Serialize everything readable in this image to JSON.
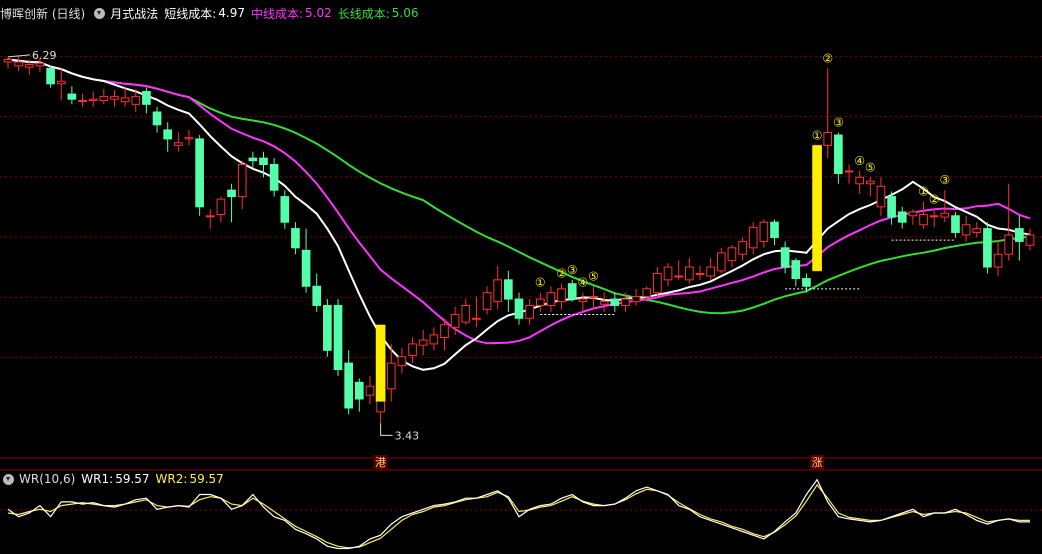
{
  "header": {
    "stock_name": "博晖创新 (日线)",
    "indicator_name": "月式战法",
    "short_label": "短线成本:",
    "short_value": "4.97",
    "mid_label": "中线成本:",
    "mid_value": "5.02",
    "long_label": "长线成本:",
    "long_value": "5.06"
  },
  "sub_header": {
    "indicator": "WR(10,6)",
    "wr1_label": "WR1:",
    "wr1_value": "59.57",
    "wr2_label": "WR2:",
    "wr2_value": "59.57"
  },
  "colors": {
    "up": "#ff3030",
    "down": "#54ffaa",
    "short_line": "#ffffff",
    "mid_line": "#ff33ff",
    "long_line": "#33dd33",
    "signal_bar": "#ffee00",
    "grid": "#8b0000",
    "circle_marker": "#ffee00",
    "wr1": "#ffffff",
    "wr2": "#ffee55"
  },
  "chart_data": {
    "type": "candlestick",
    "price_high_label": "6.29",
    "price_low_label": "3.43",
    "ylim": [
      3.3,
      6.5
    ],
    "candles": [
      [
        6.25,
        6.27,
        6.2,
        6.29
      ],
      [
        6.22,
        6.25,
        6.18,
        6.3
      ],
      [
        6.21,
        6.23,
        6.15,
        6.27
      ],
      [
        6.22,
        6.24,
        6.17,
        6.28
      ],
      [
        6.2,
        6.08,
        6.05,
        6.22
      ],
      [
        6.08,
        6.1,
        5.95,
        6.2
      ],
      [
        6.0,
        5.96,
        5.92,
        6.06
      ],
      [
        5.95,
        5.95,
        5.9,
        6.0
      ],
      [
        5.95,
        5.96,
        5.9,
        6.02
      ],
      [
        5.95,
        5.98,
        5.92,
        6.04
      ],
      [
        5.96,
        5.98,
        5.9,
        6.03
      ],
      [
        5.94,
        5.97,
        5.9,
        6.05
      ],
      [
        5.92,
        5.98,
        5.86,
        6.04
      ],
      [
        6.02,
        5.92,
        5.85,
        6.05
      ],
      [
        5.86,
        5.76,
        5.7,
        5.9
      ],
      [
        5.72,
        5.65,
        5.55,
        5.78
      ],
      [
        5.6,
        5.62,
        5.55,
        5.7
      ],
      [
        5.65,
        5.66,
        5.6,
        5.72
      ],
      [
        5.65,
        5.12,
        5.05,
        5.68
      ],
      [
        5.05,
        5.05,
        4.95,
        5.1
      ],
      [
        5.06,
        5.18,
        5.0,
        5.2
      ],
      [
        5.25,
        5.2,
        5.0,
        5.3
      ],
      [
        5.2,
        5.45,
        5.1,
        5.48
      ],
      [
        5.5,
        5.48,
        5.42,
        5.55
      ],
      [
        5.5,
        5.45,
        5.35,
        5.55
      ],
      [
        5.45,
        5.25,
        5.2,
        5.5
      ],
      [
        5.2,
        5.0,
        4.95,
        5.25
      ],
      [
        4.95,
        4.8,
        4.75,
        5.0
      ],
      [
        4.78,
        4.5,
        4.45,
        4.95
      ],
      [
        4.5,
        4.35,
        4.3,
        4.6
      ],
      [
        4.35,
        4.0,
        3.95,
        4.4
      ],
      [
        4.35,
        3.85,
        3.8,
        4.4
      ],
      [
        3.9,
        3.55,
        3.5,
        4.0
      ],
      [
        3.75,
        3.62,
        3.52,
        3.78
      ],
      [
        3.65,
        3.72,
        3.58,
        3.8
      ],
      [
        3.52,
        3.76,
        3.43,
        3.82
      ],
      [
        3.7,
        3.9,
        3.6,
        4.05
      ],
      [
        3.88,
        3.95,
        3.82,
        4.02
      ],
      [
        3.96,
        4.05,
        3.9,
        4.1
      ],
      [
        4.04,
        4.08,
        3.96,
        4.16
      ],
      [
        4.05,
        4.12,
        4.0,
        4.18
      ],
      [
        4.1,
        4.2,
        4.0,
        4.25
      ],
      [
        4.18,
        4.28,
        4.12,
        4.34
      ],
      [
        4.22,
        4.35,
        4.2,
        4.4
      ],
      [
        4.25,
        4.25,
        4.18,
        4.42
      ],
      [
        4.32,
        4.45,
        4.28,
        4.5
      ],
      [
        4.38,
        4.55,
        4.32,
        4.66
      ],
      [
        4.55,
        4.4,
        4.3,
        4.62
      ],
      [
        4.4,
        4.25,
        4.2,
        4.45
      ],
      [
        4.25,
        4.35,
        4.2,
        4.4
      ],
      [
        4.35,
        4.4,
        4.3,
        4.45
      ],
      [
        4.35,
        4.45,
        4.3,
        4.5
      ],
      [
        4.38,
        4.48,
        4.32,
        4.52
      ],
      [
        4.52,
        4.4,
        4.38,
        4.55
      ],
      [
        4.38,
        4.4,
        4.3,
        4.45
      ],
      [
        4.42,
        4.42,
        4.32,
        4.5
      ],
      [
        4.36,
        4.38,
        4.3,
        4.45
      ],
      [
        4.4,
        4.35,
        4.3,
        4.45
      ],
      [
        4.35,
        4.4,
        4.3,
        4.45
      ],
      [
        4.38,
        4.42,
        4.35,
        4.48
      ],
      [
        4.42,
        4.48,
        4.38,
        4.5
      ],
      [
        4.45,
        4.6,
        4.42,
        4.65
      ],
      [
        4.55,
        4.65,
        4.5,
        4.68
      ],
      [
        4.58,
        4.58,
        4.55,
        4.7
      ],
      [
        4.55,
        4.65,
        4.52,
        4.72
      ],
      [
        4.6,
        4.6,
        4.55,
        4.66
      ],
      [
        4.58,
        4.65,
        4.55,
        4.72
      ],
      [
        4.62,
        4.76,
        4.6,
        4.8
      ],
      [
        4.7,
        4.8,
        4.65,
        4.82
      ],
      [
        4.75,
        4.85,
        4.7,
        4.88
      ],
      [
        4.8,
        4.96,
        4.75,
        5.0
      ],
      [
        4.85,
        5.0,
        4.8,
        5.02
      ],
      [
        5.0,
        4.88,
        4.82,
        5.02
      ],
      [
        4.8,
        4.65,
        4.6,
        4.85
      ],
      [
        4.7,
        4.56,
        4.5,
        4.72
      ],
      [
        4.56,
        4.5,
        4.45,
        4.6
      ],
      [
        4.62,
        5.6,
        4.62,
        5.6
      ],
      [
        5.6,
        5.7,
        5.5,
        6.2
      ],
      [
        5.68,
        5.38,
        5.3,
        5.7
      ],
      [
        5.4,
        5.4,
        5.3,
        5.45
      ],
      [
        5.3,
        5.35,
        5.22,
        5.4
      ],
      [
        5.3,
        5.32,
        5.2,
        5.35
      ],
      [
        5.12,
        5.28,
        5.05,
        5.35
      ],
      [
        5.2,
        5.04,
        4.98,
        5.24
      ],
      [
        5.08,
        5.0,
        4.95,
        5.12
      ],
      [
        5.05,
        5.08,
        4.98,
        5.1
      ],
      [
        4.98,
        5.06,
        4.95,
        5.16
      ],
      [
        5.05,
        5.05,
        4.96,
        5.1
      ],
      [
        5.04,
        5.07,
        5.0,
        5.25
      ],
      [
        5.05,
        4.92,
        4.88,
        5.08
      ],
      [
        4.9,
        4.98,
        4.85,
        5.05
      ],
      [
        4.92,
        4.95,
        4.88,
        5.0
      ],
      [
        4.95,
        4.65,
        4.6,
        5.0
      ],
      [
        4.65,
        4.75,
        4.58,
        4.86
      ],
      [
        4.75,
        4.9,
        4.7,
        5.3
      ],
      [
        4.95,
        4.85,
        4.7,
        5.05
      ],
      [
        4.82,
        4.9,
        4.78,
        4.95
      ]
    ],
    "signal_bars": [
      {
        "index": 35,
        "open": 3.6,
        "close": 4.2
      },
      {
        "index": 76,
        "open": 4.62,
        "close": 5.6
      }
    ],
    "circle_markers": [
      {
        "index": 50,
        "label": "①"
      },
      {
        "index": 52,
        "label": "②"
      },
      {
        "index": 53,
        "label": "③"
      },
      {
        "index": 54,
        "label": "④"
      },
      {
        "index": 55,
        "label": "⑤"
      },
      {
        "index": 76,
        "label": "①"
      },
      {
        "index": 77,
        "label": "②"
      },
      {
        "index": 78,
        "label": "③"
      },
      {
        "index": 80,
        "label": "④"
      },
      {
        "index": 81,
        "label": "⑤"
      },
      {
        "index": 86,
        "label": "①"
      },
      {
        "index": 87,
        "label": "②"
      },
      {
        "index": 88,
        "label": "③"
      }
    ],
    "support_lines": [
      {
        "from_index": 50,
        "to_index": 57,
        "value": 4.28
      },
      {
        "from_index": 73,
        "to_index": 80,
        "value": 4.48
      },
      {
        "from_index": 83,
        "to_index": 89,
        "value": 4.86
      }
    ],
    "bottom_labels": [
      {
        "index": 35,
        "text": "港"
      },
      {
        "index": 76,
        "text": "涨"
      }
    ],
    "wr1": [
      45,
      55,
      50,
      40,
      55,
      35,
      35,
      38,
      36,
      40,
      42,
      38,
      32,
      30,
      45,
      42,
      40,
      42,
      25,
      25,
      30,
      45,
      40,
      25,
      42,
      55,
      60,
      72,
      78,
      85,
      95,
      98,
      98,
      95,
      85,
      80,
      65,
      55,
      50,
      45,
      40,
      38,
      35,
      30,
      30,
      25,
      20,
      30,
      55,
      45,
      40,
      38,
      30,
      25,
      35,
      40,
      40,
      38,
      30,
      20,
      15,
      20,
      25,
      40,
      45,
      55,
      60,
      65,
      70,
      75,
      80,
      85,
      75,
      62,
      50,
      25,
      5,
      35,
      55,
      58,
      60,
      62,
      60,
      55,
      50,
      45,
      55,
      50,
      50,
      45,
      52,
      60,
      65,
      60,
      58,
      62,
      62
    ],
    "wr2": [
      50,
      52,
      48,
      45,
      48,
      40,
      38,
      36,
      38,
      40,
      40,
      38,
      35,
      32,
      40,
      42,
      40,
      41,
      32,
      28,
      30,
      38,
      40,
      30,
      38,
      48,
      58,
      68,
      75,
      82,
      90,
      95,
      97,
      96,
      90,
      84,
      72,
      60,
      52,
      48,
      42,
      40,
      36,
      32,
      30,
      28,
      22,
      28,
      48,
      46,
      42,
      40,
      34,
      28,
      34,
      38,
      40,
      38,
      32,
      24,
      18,
      20,
      26,
      36,
      44,
      52,
      58,
      62,
      68,
      72,
      78,
      82,
      76,
      66,
      54,
      34,
      12,
      30,
      50,
      56,
      58,
      60,
      60,
      56,
      52,
      48,
      52,
      50,
      50,
      48,
      50,
      56,
      62,
      60,
      58,
      60,
      60
    ]
  }
}
